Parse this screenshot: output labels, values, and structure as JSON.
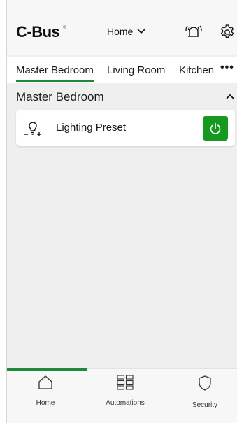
{
  "header": {
    "logo": "C-Bus",
    "logo_mark": "®",
    "home_selector": "Home"
  },
  "tabs": [
    {
      "label": "Master Bedroom",
      "active": true
    },
    {
      "label": "Living Room",
      "active": false
    },
    {
      "label": "Kitchen",
      "active": false
    }
  ],
  "tabs_more": "•••",
  "section": {
    "title": "Master Bedroom",
    "expanded": true
  },
  "cards": [
    {
      "label": "Lighting Preset",
      "icon": "lightbulb-icon",
      "state": "on"
    }
  ],
  "bottom_nav": [
    {
      "label": "Home",
      "icon": "home-icon",
      "active": true
    },
    {
      "label": "Automations",
      "icon": "grid-icon",
      "active": false
    },
    {
      "label": "Security",
      "icon": "shield-icon",
      "active": false
    }
  ],
  "colors": {
    "accent": "#1d8a3a",
    "power_on": "#159a1f"
  }
}
